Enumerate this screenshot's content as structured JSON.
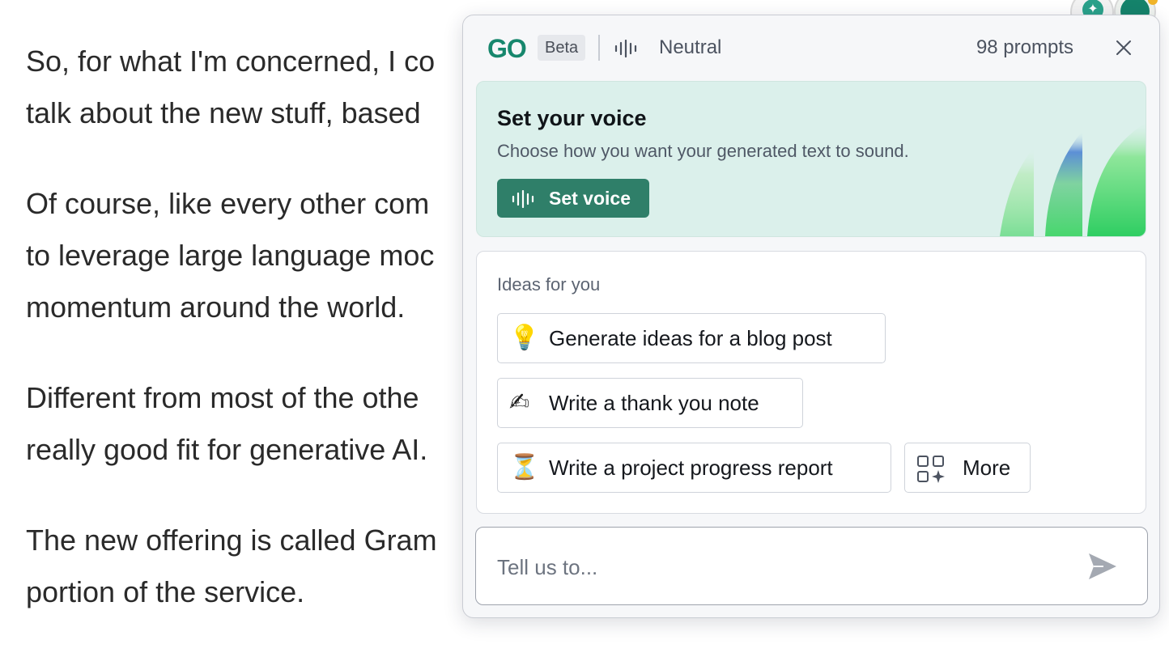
{
  "article": {
    "paragraphs": [
      [
        "So, for what I'm concerned, I co",
        "talk about the new stuff, based"
      ],
      [
        "Of course, like every other com",
        "to leverage large language moc",
        "momentum around the world."
      ],
      [
        "Different from most of the othe",
        "really good fit for generative AI."
      ],
      [
        "The new offering is called Gram",
        "portion of the service."
      ]
    ]
  },
  "panel": {
    "logo": "GO",
    "badge": "Beta",
    "voice_label": "Neutral",
    "prompts_count": "98 prompts",
    "voice_card": {
      "title": "Set your voice",
      "subtitle": "Choose how you want your generated text to sound.",
      "button_label": "Set voice"
    },
    "ideas": {
      "title": "Ideas for you",
      "items": [
        {
          "emoji": "💡",
          "label": "Generate ideas for a blog post"
        },
        {
          "emoji": "✍",
          "label": "Write a thank you note"
        },
        {
          "emoji": "⏳",
          "label": "Write a project progress report"
        }
      ],
      "more_label": "More"
    },
    "input": {
      "placeholder": "Tell us to...",
      "value": ""
    }
  },
  "colors": {
    "accent": "#17876d",
    "button": "#2f7f69",
    "voice_card_bg": "#dbf0eb"
  }
}
